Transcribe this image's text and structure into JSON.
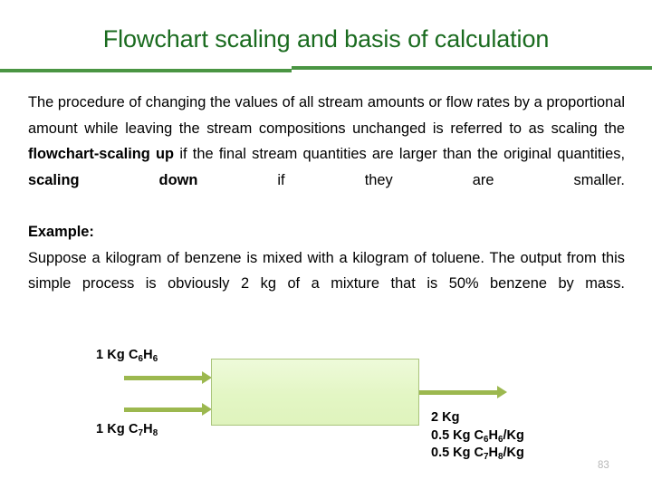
{
  "slide": {
    "title": "Flowchart scaling and basis of calculation",
    "number": "83",
    "title_color": "#1a6b1f",
    "divider_color": "#4a9543"
  },
  "body": {
    "paragraph_segments": [
      {
        "text": "The procedure of changing the values of all stream amounts or flow rates by a proportional amount while leaving the stream compositions unchanged is referred to as scaling the ",
        "bold": false
      },
      {
        "text": "flowchart-scaling up",
        "bold": true
      },
      {
        "text": " if the final stream quantities are larger than the original quantities, ",
        "bold": false
      },
      {
        "text": "scaling down",
        "bold": true
      },
      {
        "text": " if they are smaller.",
        "bold": false
      }
    ],
    "example_heading": "Example:",
    "example_text": "Suppose a kilogram of benzene is mixed with a kilogram of toluene. The output from this simple process is obviously 2 kg of a mixture that is 50% benzene by mass."
  },
  "diagram": {
    "inputs": [
      {
        "amount": "1 Kg",
        "formula_base_1": "C",
        "formula_sub_1": "6",
        "formula_base_2": "H",
        "formula_sub_2": "6"
      },
      {
        "amount": "1 Kg",
        "formula_base_1": "C",
        "formula_sub_1": "7",
        "formula_base_2": "H",
        "formula_sub_2": "8"
      }
    ],
    "output_lines": [
      {
        "prefix": "2 Kg",
        "sub_a": "",
        "mid": "",
        "sub_b": "",
        "suffix": ""
      },
      {
        "prefix": "0.5 Kg C",
        "sub_a": "6",
        "mid": "H",
        "sub_b": "6",
        "suffix": "/Kg"
      },
      {
        "prefix": "0.5 Kg C",
        "sub_a": "7",
        "mid": "H",
        "sub_b": "8",
        "suffix": "/Kg"
      }
    ],
    "process_box_fill": "#e3f6c4",
    "process_box_border": "#a9c47a",
    "arrow_color": "#9cb84f"
  }
}
